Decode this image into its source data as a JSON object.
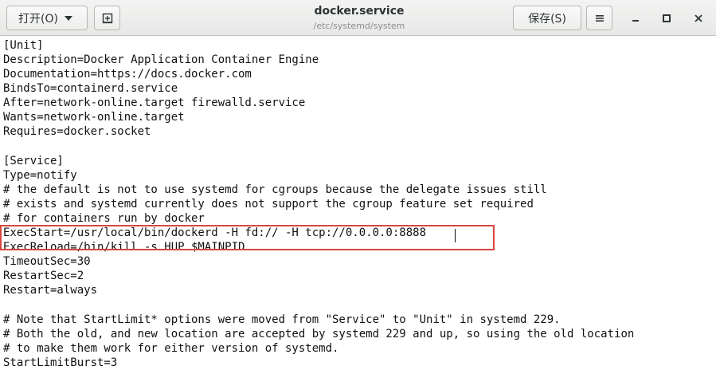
{
  "header": {
    "open_label": "打开(O)",
    "save_label": "保存(S)",
    "title": "docker.service",
    "subtitle": "/etc/systemd/system"
  },
  "icons": {
    "open_dropdown": "chevron-down-icon",
    "new_document": "new-document-icon",
    "menu": "hamburger-menu-icon",
    "minimize": "minimize-icon",
    "maximize": "maximize-icon",
    "close": "close-icon"
  },
  "colors": {
    "highlight_border": "#d9463d",
    "header_bg": "#ececeb",
    "text": "#111111"
  },
  "editor": {
    "highlighted_lines": [
      16
    ],
    "lines": [
      "[Unit]",
      "Description=Docker Application Container Engine",
      "Documentation=https://docs.docker.com",
      "BindsTo=containerd.service",
      "After=network-online.target firewalld.service",
      "Wants=network-online.target",
      "Requires=docker.socket",
      "",
      "[Service]",
      "Type=notify",
      "# the default is not to use systemd for cgroups because the delegate issues still",
      "# exists and systemd currently does not support the cgroup feature set required",
      "# for containers run by docker",
      "ExecStart=/usr/local/bin/dockerd -H fd:// -H tcp://0.0.0.0:8888",
      "ExecReload=/bin/kill -s HUP $MAINPID",
      "TimeoutSec=30",
      "RestartSec=2",
      "Restart=always",
      "",
      "# Note that StartLimit* options were moved from \"Service\" to \"Unit\" in systemd 229.",
      "# Both the old, and new location are accepted by systemd 229 and up, so using the old location",
      "# to make them work for either version of systemd.",
      "StartLimitBurst=3"
    ]
  }
}
